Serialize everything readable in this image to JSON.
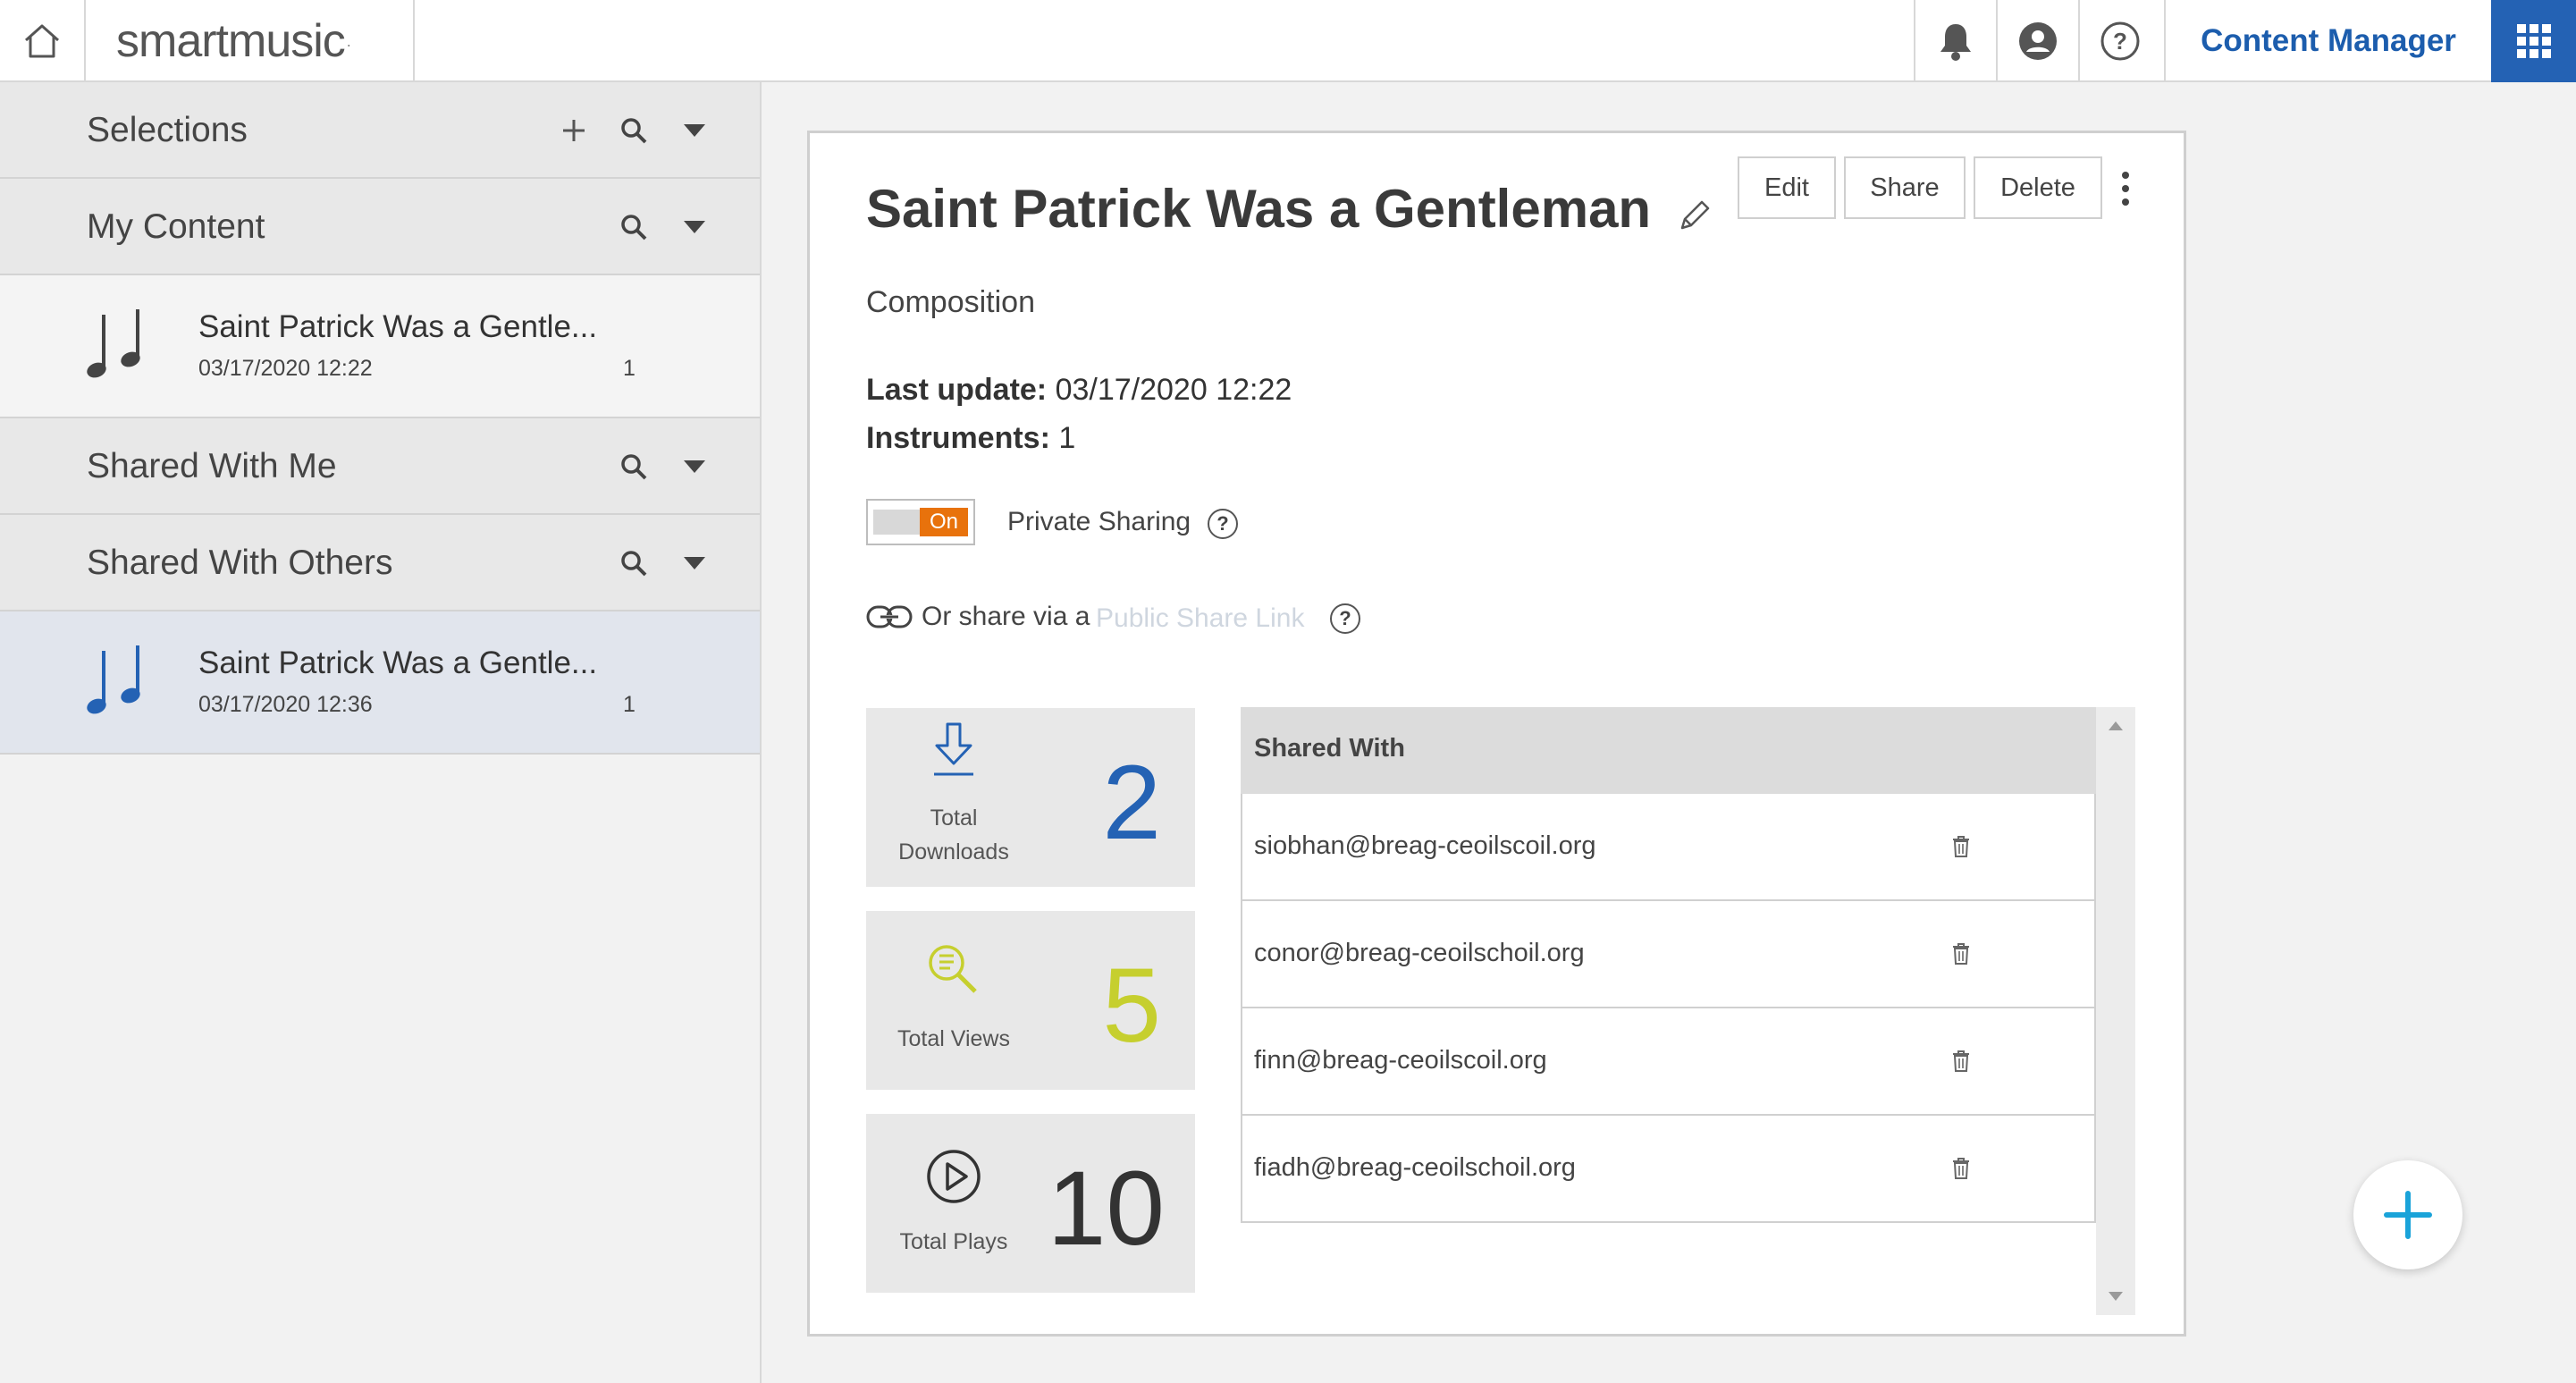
{
  "topbar": {
    "brand": "smartmusic",
    "brand_mark": ".",
    "content_manager_label": "Content Manager",
    "icons": [
      "home-icon",
      "bell-icon",
      "account-icon",
      "help-icon",
      "apps-grid-icon"
    ]
  },
  "sidebar": {
    "sections": [
      {
        "title": "Selections",
        "actions": [
          "add-icon",
          "search-icon",
          "chevron-down-icon"
        ]
      },
      {
        "title": "My Content",
        "actions": [
          "search-icon",
          "chevron-down-icon"
        ]
      },
      {
        "title": "Shared With Me",
        "actions": [
          "search-icon",
          "chevron-down-icon"
        ]
      },
      {
        "title": "Shared With Others",
        "actions": [
          "search-icon",
          "chevron-down-icon"
        ]
      }
    ],
    "my_content_items": [
      {
        "title": "Saint Patrick Was a Gentle...",
        "date": "03/17/2020 12:22",
        "count": "1",
        "icon": "music-notes-icon"
      }
    ],
    "shared_with_others_items": [
      {
        "title": "Saint Patrick Was a Gentle...",
        "date": "03/17/2020 12:36",
        "count": "1",
        "icon": "music-notes-icon",
        "selected": true
      }
    ]
  },
  "detail": {
    "title": "Saint Patrick Was a Gentleman",
    "type": "Composition",
    "last_update_label": "Last update:",
    "last_update_value": "03/17/2020 12:22",
    "instruments_label": "Instruments:",
    "instruments_value": "1",
    "buttons": {
      "edit": "Edit",
      "share": "Share",
      "delete": "Delete"
    },
    "private_sharing": {
      "toggle_state": "On",
      "label": "Private Sharing",
      "help": "?"
    },
    "public_share": {
      "prefix": "Or share via a",
      "link_text": "Public Share Link",
      "help": "?"
    },
    "stats": [
      {
        "label_line1": "Total",
        "label_line2": "Downloads",
        "value": "2",
        "color": "#2462b4",
        "icon": "download-icon"
      },
      {
        "label_line1": "Total Views",
        "label_line2": "",
        "value": "5",
        "color": "#c6cf2e",
        "icon": "view-search-icon"
      },
      {
        "label_line1": "Total Plays",
        "label_line2": "",
        "value": "10",
        "color": "#333333",
        "icon": "play-circle-icon"
      }
    ],
    "shared_with": {
      "header": "Shared With",
      "rows": [
        "siobhan@breag-ceoilscoil.org",
        "conor@breag-ceoilschoil.org",
        "finn@breag-ceoilscoil.org",
        "fiadh@breag-ceoilschoil.org"
      ]
    }
  },
  "colors": {
    "accent": "#2462b4",
    "toggle_on": "#e8720c",
    "fab_plus": "#1aa3d9"
  }
}
